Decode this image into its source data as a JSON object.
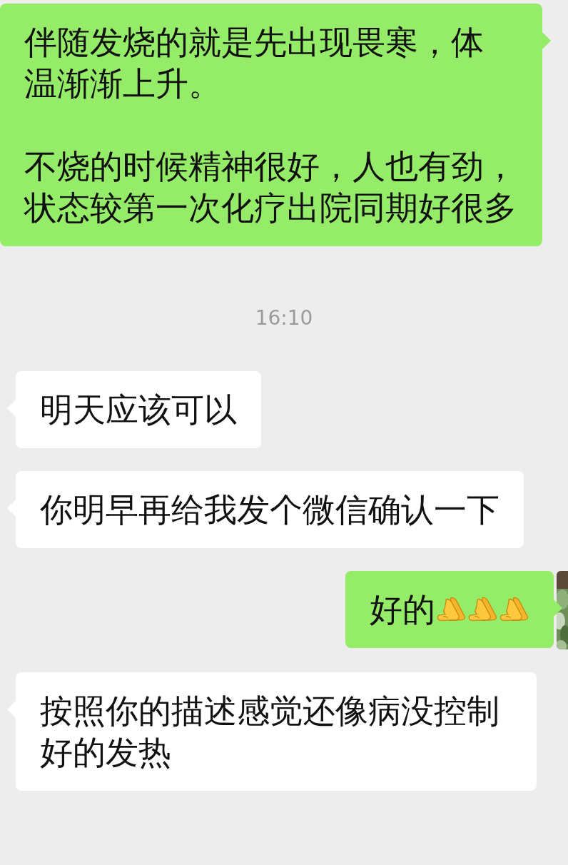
{
  "messages": [
    {
      "kind": "message",
      "outgoing": true,
      "paragraphs": [
        "伴随发烧的就是先出现畏寒，体温渐渐上升。",
        "不烧的时候精神很好，人也有劲，状态较第一次化疗出院同期好很多"
      ]
    },
    {
      "kind": "time",
      "text": "16:10"
    },
    {
      "kind": "message",
      "outgoing": false,
      "paragraphs": [
        "明天应该可以"
      ]
    },
    {
      "kind": "message",
      "outgoing": false,
      "paragraphs": [
        "你明早再给我发个微信确认一下"
      ]
    },
    {
      "kind": "message",
      "outgoing": true,
      "paragraphs": [
        "好的"
      ],
      "emoji": [
        {
          "kind": "pray"
        },
        {
          "kind": "pray"
        },
        {
          "kind": "pray"
        }
      ],
      "avatar": true
    },
    {
      "kind": "message",
      "outgoing": false,
      "paragraphs": [
        "按照你的描述感觉还像病没控制好的发热"
      ]
    }
  ]
}
